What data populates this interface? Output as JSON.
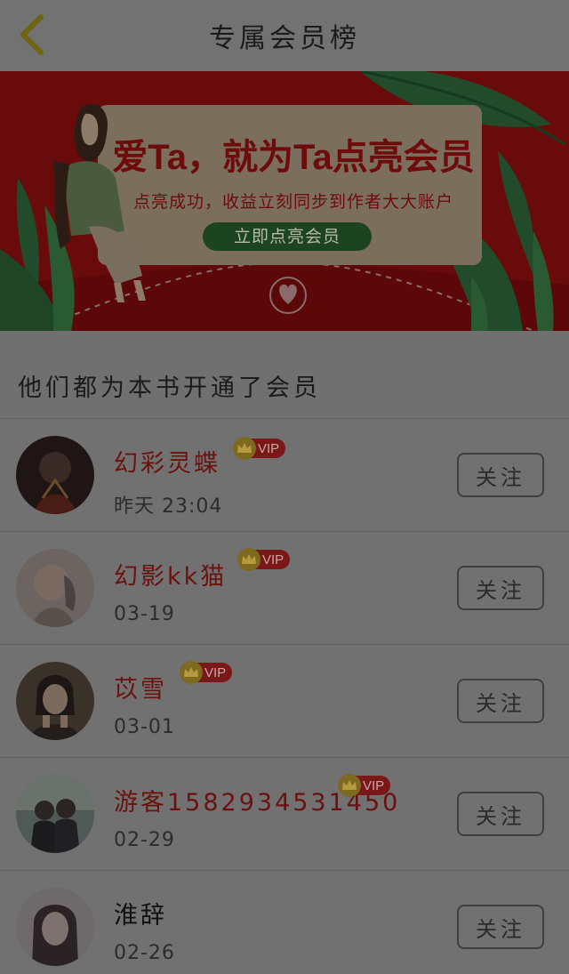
{
  "header": {
    "title": "专属会员榜"
  },
  "banner": {
    "headline": "爱Ta，就为Ta点亮会员",
    "subtitle": "点亮成功，收益立刻同步到作者大大账户",
    "cta_label": "立即点亮会员"
  },
  "section": {
    "title": "他们都为本书开通了会员"
  },
  "members": [
    {
      "name": "幻彩灵蝶",
      "vip": "VIP",
      "time": "昨天 23:04",
      "follow": "关注",
      "name_color": "red"
    },
    {
      "name": "幻影kk猫",
      "vip": "VIP",
      "time": "03-19",
      "follow": "关注",
      "name_color": "red"
    },
    {
      "name": "苡雪",
      "vip": "VIP",
      "time": "03-01",
      "follow": "关注",
      "name_color": "red"
    },
    {
      "name": "游客1582934531450",
      "vip": "VIP",
      "time": "02-29",
      "follow": "关注",
      "name_color": "red"
    },
    {
      "name": "淮辞",
      "vip": null,
      "time": "02-26",
      "follow": "关注",
      "name_color": "plain"
    }
  ],
  "colors": {
    "overlay_bg": "#6f6f6f",
    "banner_red": "#6a0b0b",
    "vip_red": "#7a1717",
    "name_red": "#6a120e",
    "cta_green": "#1d4421"
  },
  "icons": {
    "back": "chevron-left-icon",
    "vip": "crown-icon"
  }
}
